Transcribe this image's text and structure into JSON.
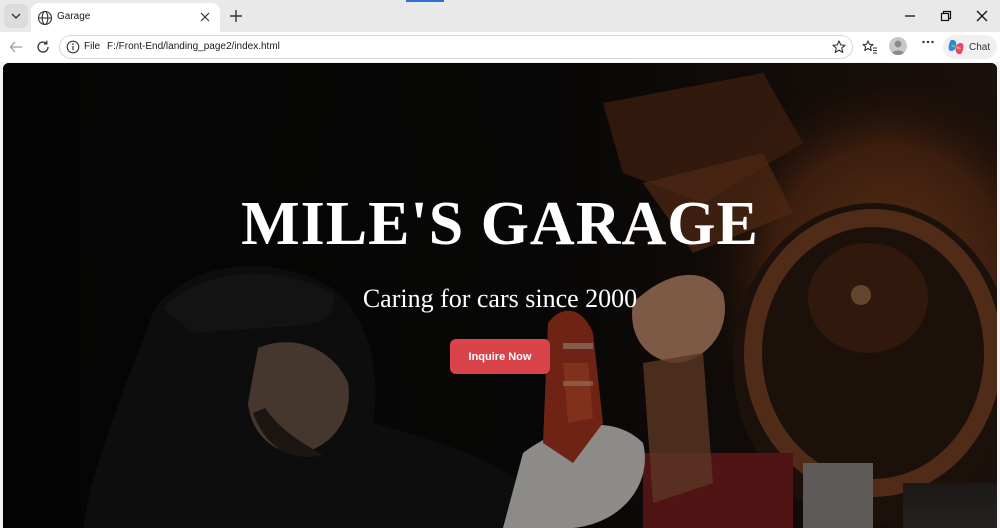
{
  "browser": {
    "tab": {
      "title": "Garage",
      "favicon": "globe-icon"
    },
    "address": {
      "scheme": "File",
      "url": "F:/Front-End/landing_page2/index.html"
    },
    "chat_label": "Chat",
    "icons": [
      "tab-actions-icon",
      "new-tab-icon",
      "minimize-icon",
      "restore-icon",
      "close-window-icon",
      "back-icon",
      "refresh-icon",
      "info-icon",
      "favorite-star-icon",
      "favorites-icon",
      "profile-avatar-icon",
      "more-icon",
      "copilot-icon"
    ]
  },
  "hero": {
    "title": "MILE'S GARAGE",
    "subtitle": "Caring for cars since 2000",
    "cta_label": "Inquire Now"
  },
  "colors": {
    "cta": "#d9434a",
    "tab_accent": "#2f6fd6",
    "hero_text": "#ffffff"
  }
}
